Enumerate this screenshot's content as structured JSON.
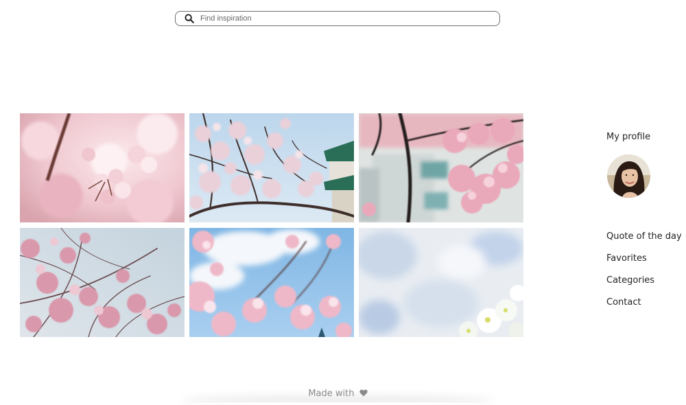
{
  "search": {
    "placeholder": "Find inspiration",
    "icon": "search-icon"
  },
  "gallery": {
    "photos": [
      {
        "subject": "pink cherry blossoms close-up",
        "palette": [
          "#f4d6da",
          "#e9b7c0",
          "#d79aa6",
          "#6b3b36"
        ]
      },
      {
        "subject": "cherry blossoms with castle and blue sky",
        "palette": [
          "#cfe0ef",
          "#e8c9d3",
          "#4a3633",
          "#1f5c4b"
        ]
      },
      {
        "subject": "cherry blossom branch in front of building",
        "palette": [
          "#dfe6e6",
          "#eab0c0",
          "#2a2424",
          "#8fb4b5"
        ]
      },
      {
        "subject": "cherry tree branches against pale sky",
        "palette": [
          "#cfd9e2",
          "#e3b4c2",
          "#6a4b50",
          "#f0d5dd"
        ]
      },
      {
        "subject": "cherry blossoms against blue sky with clouds",
        "palette": [
          "#8fc0e8",
          "#f3e3ea",
          "#e6a9bb",
          "#5a4040"
        ]
      },
      {
        "subject": "white blossoms against cloudy sky",
        "palette": [
          "#e8edf3",
          "#c5d4e6",
          "#ffffff",
          "#d6e07a"
        ]
      }
    ]
  },
  "sidebar": {
    "profile_title": "My profile",
    "avatar": "avatar",
    "menu": [
      {
        "label": "Quote of the day"
      },
      {
        "label": "Favorites"
      },
      {
        "label": "Categories"
      },
      {
        "label": "Contact"
      }
    ]
  },
  "footer": {
    "text": "Made with",
    "icon": "heart-icon"
  },
  "colors": {
    "text": "#222222",
    "footer_text": "#8a8a8a",
    "border": "#6f6f6f"
  }
}
